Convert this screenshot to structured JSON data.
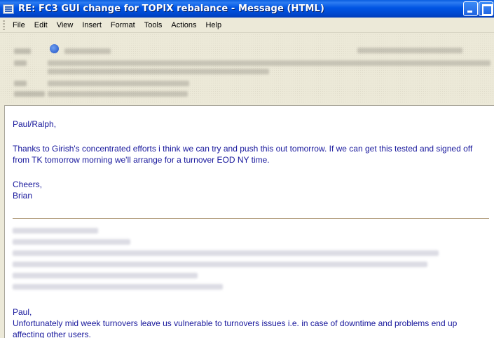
{
  "window": {
    "title": "RE: FC3 GUI change for TOPIX rebalance  - Message (HTML)"
  },
  "menu": [
    {
      "label": "File"
    },
    {
      "label": "Edit"
    },
    {
      "label": "View"
    },
    {
      "label": "Insert"
    },
    {
      "label": "Format"
    },
    {
      "label": "Tools"
    },
    {
      "label": "Actions"
    },
    {
      "label": "Help"
    }
  ],
  "message": {
    "greeting": "Paul/Ralph,",
    "paragraph": "Thanks to Girish's concentrated efforts i think we can try and push this out tomorrow. If we can get this tested and signed off from TK tomorrow morning we'll arrange for a turnover EOD NY time.",
    "signoff": "Cheers,",
    "signature": "Brian",
    "quoted_greeting": "Paul,",
    "quoted_paragraph": "Unfortunately mid week turnovers leave us vulnerable to turnovers issues i.e. in case of downtime and problems end up affecting other users."
  },
  "colors": {
    "titlebar": "#0054e3",
    "body_text": "#17179c",
    "divider": "#b29d7d"
  }
}
